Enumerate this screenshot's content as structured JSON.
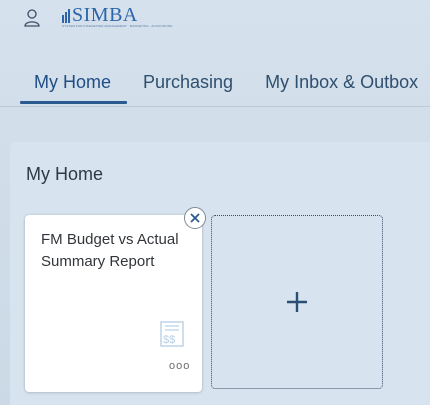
{
  "header": {
    "user_icon": "user-icon",
    "logo": {
      "text": "SIMBA",
      "tagline": "SYSTEM FOR INTEGRATED MANAGEMENT · BUDGETING · ACCOUNTING"
    }
  },
  "nav": {
    "tabs": [
      {
        "label": "My Home",
        "active": true
      },
      {
        "label": "Purchasing",
        "active": false
      },
      {
        "label": "My Inbox & Outbox",
        "active": false
      }
    ]
  },
  "section": {
    "title": "My Home",
    "tiles": [
      {
        "title": "FM Budget vs Actual Summary Report",
        "icon": "budget-report-icon",
        "more": "ooo"
      }
    ],
    "add_tile": {
      "icon": "plus-icon"
    }
  },
  "colors": {
    "background": "#cbd9e6",
    "section_bg": "#d7e3ee",
    "accent": "#2a5a8f",
    "logo": "#2d66a8",
    "tile_bg": "#ffffff"
  }
}
